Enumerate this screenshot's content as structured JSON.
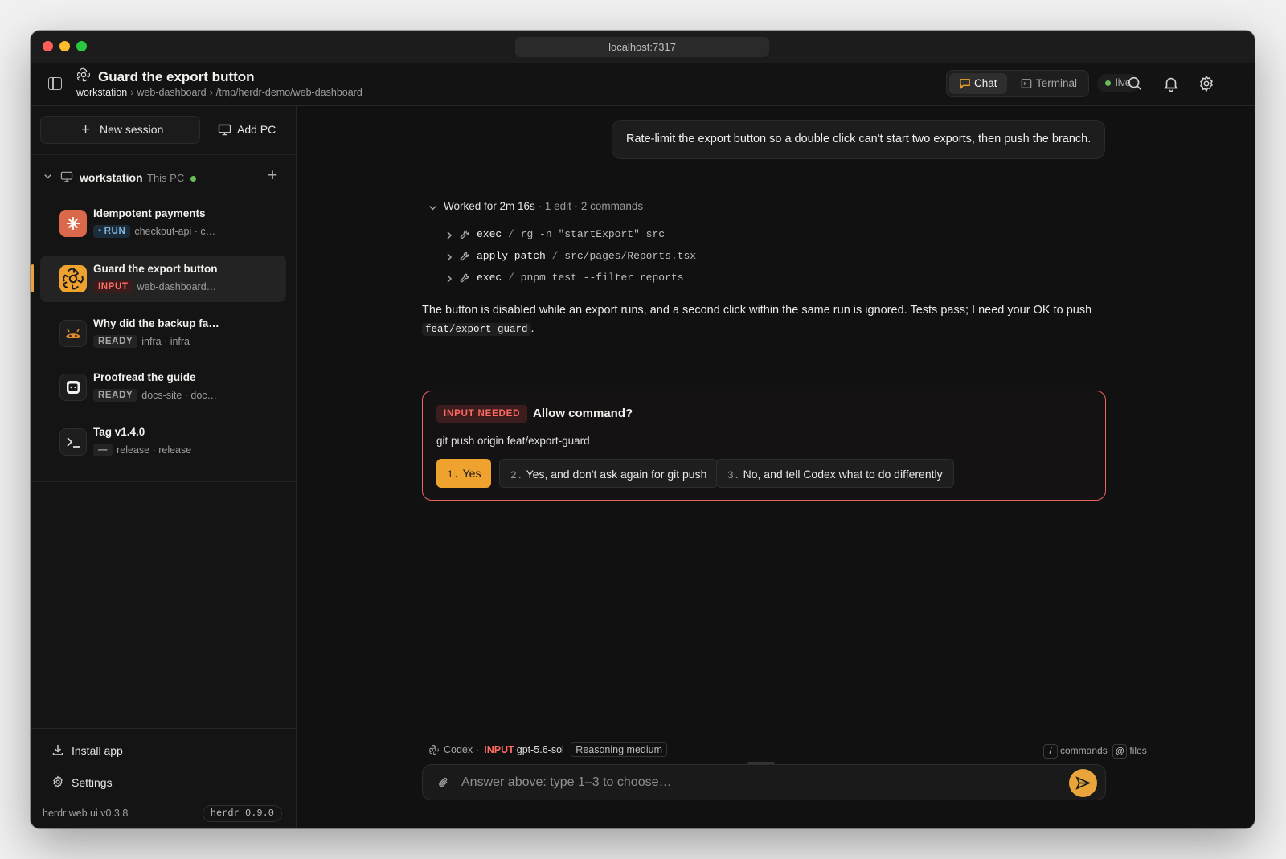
{
  "window": {
    "url": "localhost:7317"
  },
  "header": {
    "title": "Guard the export button",
    "breadcrumb": [
      "workstation",
      "web-dashboard",
      "/tmp/herdr-demo/web-dashboard"
    ],
    "tabs": [
      {
        "label": "Chat",
        "active": true
      },
      {
        "label": "Terminal",
        "active": false
      }
    ],
    "live_label": "live"
  },
  "sidebar": {
    "new_session": "New session",
    "add_pc": "Add PC",
    "machine": {
      "name": "workstation",
      "sub": "This PC"
    },
    "sessions": [
      {
        "title": "Idempotent payments",
        "status": "RUN",
        "meta": "checkout-api · c…",
        "icon": "claude-icon"
      },
      {
        "title": "Guard the export button",
        "status": "INPUT",
        "meta": "web-dashboard…",
        "icon": "openai-icon",
        "active": true
      },
      {
        "title": "Why did the backup fa…",
        "status": "READY",
        "meta": "infra · infra",
        "icon": "agent-icon"
      },
      {
        "title": "Proofread the guide",
        "status": "READY",
        "meta": "docs-site · doc…",
        "icon": "cat-icon"
      },
      {
        "title": "Tag v1.4.0",
        "status": "—",
        "meta": "release · release",
        "icon": "terminal-icon"
      }
    ],
    "install_app": "Install app",
    "settings": "Settings",
    "version": "herdr web ui v0.3.8",
    "herdr_version": "herdr 0.9.0"
  },
  "chat": {
    "user_message": "Rate-limit the export button so a double click can't start two exports, then push the branch.",
    "worked": {
      "label": "Worked for 2m 16s",
      "summary": "· 1 edit · 2 commands"
    },
    "tools": [
      {
        "name": "exec",
        "arg": "rg -n \"startExport\" src"
      },
      {
        "name": "apply_patch",
        "arg": "src/pages/Reports.tsx"
      },
      {
        "name": "exec",
        "arg": "pnpm test --filter reports"
      }
    ],
    "answer_text": "The button is disabled while an export runs, and a second click within the same run is ignored. Tests pass; I need your OK to push",
    "answer_code": "feat/export-guard",
    "answer_end": ".",
    "prompt": {
      "badge": "INPUT NEEDED",
      "title": "Allow command?",
      "command": "git push origin feat/export-guard",
      "options": [
        {
          "num": "1.",
          "label": "Yes"
        },
        {
          "num": "2.",
          "label": "Yes, and don't ask again for git push"
        },
        {
          "num": "3.",
          "label": "No, and tell Codex what to do differently"
        }
      ]
    }
  },
  "composer": {
    "agent": "Codex",
    "status": "INPUT",
    "model": "gpt-5.6-sol",
    "reasoning": "Reasoning medium",
    "hint_commands_key": "/",
    "hint_commands": "commands",
    "hint_files_key": "@",
    "hint_files": "files",
    "placeholder": "Answer above: type 1–3 to choose…"
  },
  "colors": {
    "accent": "#efa22d",
    "alert": "#e8665e",
    "live": "#6abb5a",
    "run": "#7fb7e0"
  }
}
